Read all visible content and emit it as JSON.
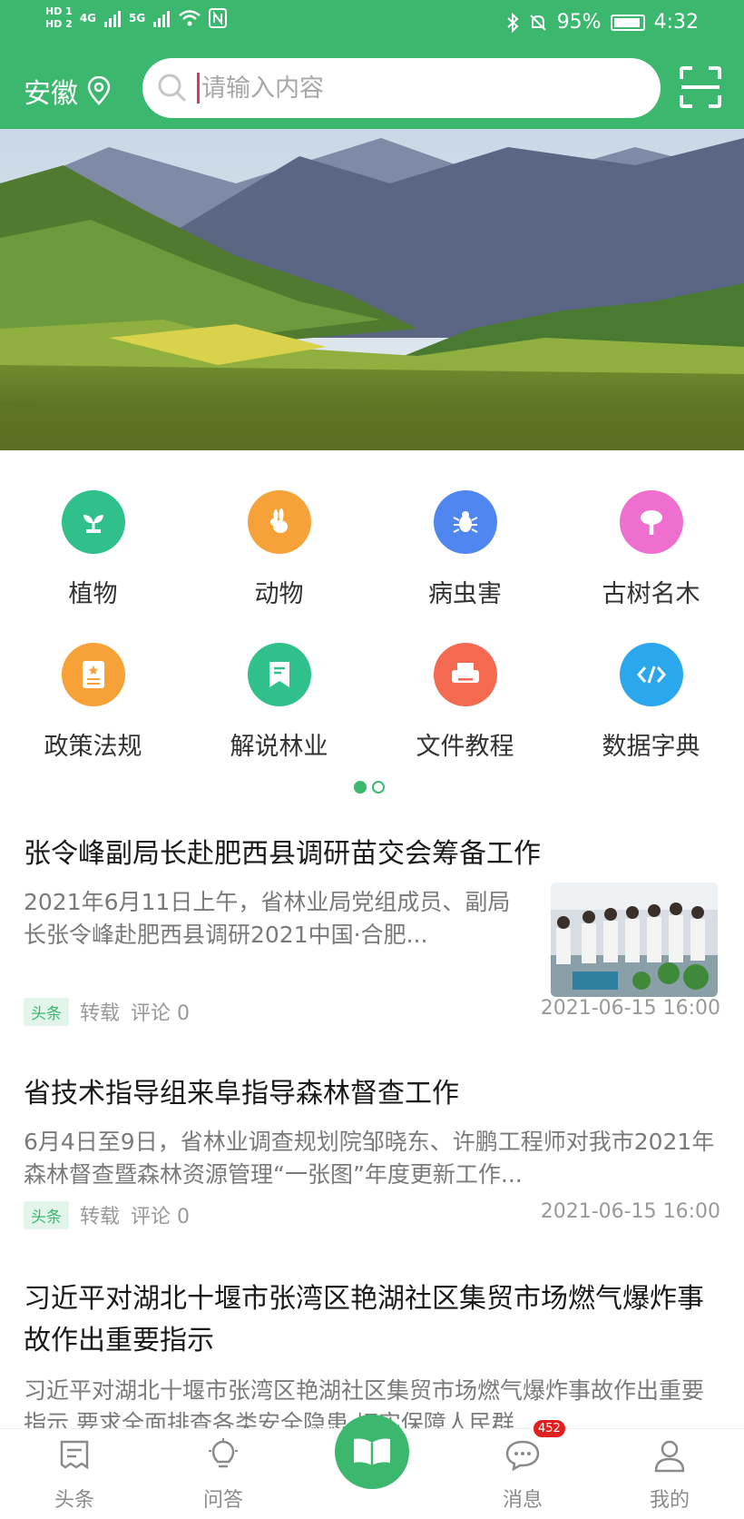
{
  "status_bar": {
    "hd1": "HD 1",
    "hd2": "HD 2",
    "signal1": "4G",
    "signal2": "5G",
    "battery": "95%",
    "time": "4:32"
  },
  "header": {
    "location": "安徽",
    "search_placeholder": "请输入内容",
    "accent_color": "#3cb76e"
  },
  "categories": [
    {
      "label": "植物",
      "icon": "seedling-icon",
      "color": "#2fc08c"
    },
    {
      "label": "动物",
      "icon": "rabbit-icon",
      "color": "#f7a239"
    },
    {
      "label": "病虫害",
      "icon": "bug-icon",
      "color": "#4f86ef"
    },
    {
      "label": "古树名木",
      "icon": "tree-icon",
      "color": "#ef6fcf"
    },
    {
      "label": "政策法规",
      "icon": "document-star-icon",
      "color": "#f7a239"
    },
    {
      "label": "解说林业",
      "icon": "bookmark-icon",
      "color": "#2fc08c"
    },
    {
      "label": "文件教程",
      "icon": "printer-icon",
      "color": "#f46a50"
    },
    {
      "label": "数据字典",
      "icon": "code-icon",
      "color": "#2ba7ee"
    }
  ],
  "pager": {
    "pages": 2,
    "active": 1
  },
  "news": [
    {
      "title": "张令峰副局长赴肥西县调研苗交会筹备工作",
      "desc": "2021年6月11日上午，省林业局党组成员、副局长张令峰赴肥西县调研2021中国·合肥...",
      "tag": "头条",
      "source": "转载",
      "comments": "评论 0",
      "date": "2021-06-15 16:00"
    },
    {
      "title": "省技术指导组来阜指导森林督查工作",
      "desc": "6月4日至9日，省林业调查规划院邹晓东、许鹏工程师对我市2021年森林督查暨森林资源管理“一张图”年度更新工作...",
      "tag": "头条",
      "source": "转载",
      "comments": "评论 0",
      "date": "2021-06-15 16:00"
    },
    {
      "title": "习近平对湖北十堰市张湾区艳湖社区集贸市场燃气爆炸事故作出重要指示",
      "desc": "习近平对湖北十堰市张湾区艳湖社区集贸市场燃气爆炸事故作出重要指示 要求全面排查各类安全隐患 切实保障人民群..."
    }
  ],
  "bottom_nav": {
    "tabs": [
      "头条",
      "问答",
      "",
      "消息",
      "我的"
    ],
    "message_badge": "452"
  }
}
